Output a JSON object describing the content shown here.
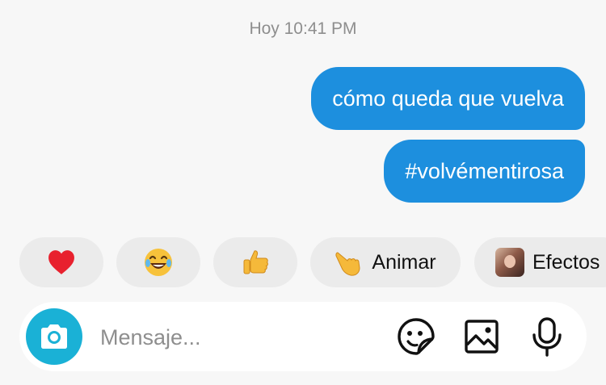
{
  "timestamp": "Hoy 10:41 PM",
  "messages": [
    {
      "text": "cómo queda que vuelva",
      "from": "me"
    },
    {
      "text": "#volvémentirosa",
      "from": "me"
    }
  ],
  "reactions": [
    {
      "icon": "heart-icon"
    },
    {
      "icon": "laughing-face-icon"
    },
    {
      "icon": "thumbs-up-icon"
    },
    {
      "icon": "pointing-hand-icon",
      "label": "Animar"
    },
    {
      "icon": "effects-thumbnail",
      "label": "Efectos"
    }
  ],
  "composer": {
    "placeholder": "Mensaje...",
    "actions": [
      "sticker-icon",
      "gallery-icon",
      "microphone-icon"
    ]
  },
  "colors": {
    "bubble": "#1d8fde",
    "camera": "#1ab1d6",
    "chip": "#ebebeb",
    "background": "#f7f7f7"
  }
}
